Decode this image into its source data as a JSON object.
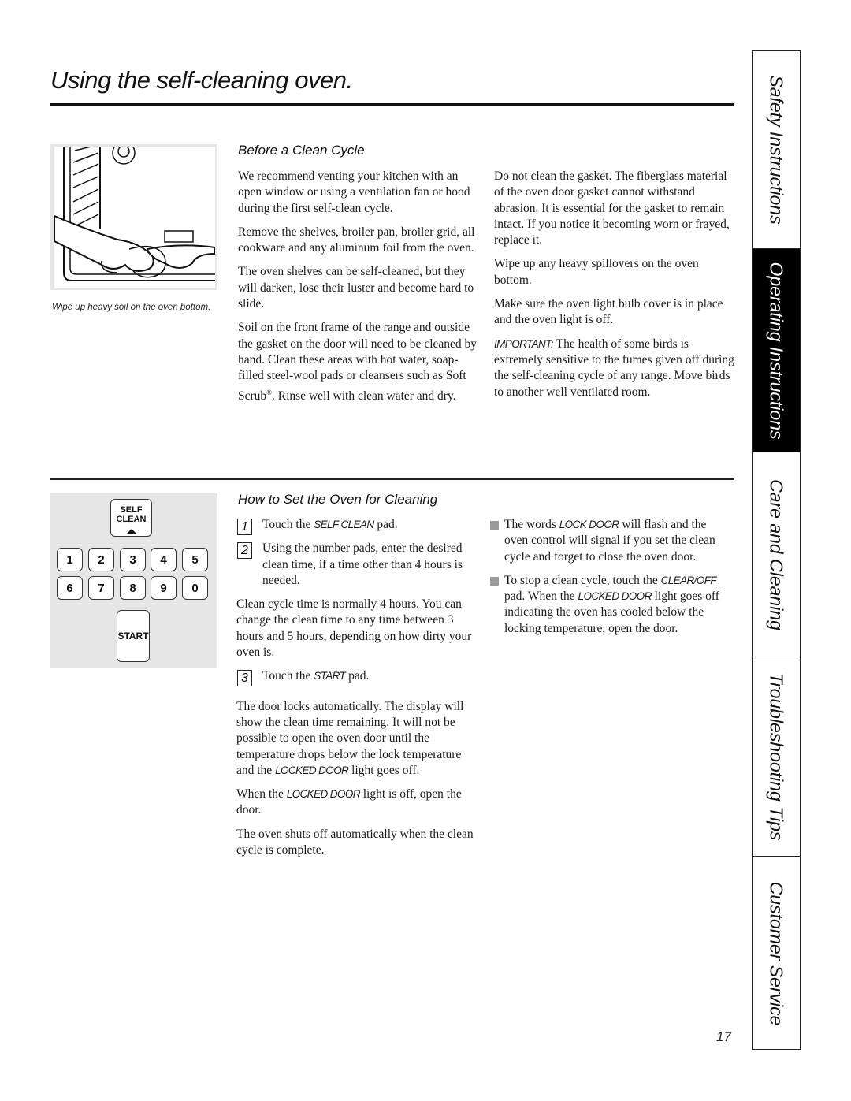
{
  "page": {
    "title": "Using the self-cleaning oven.",
    "number": "17"
  },
  "before_clean": {
    "heading": "Before a Clean Cycle",
    "figure_caption": "Wipe up heavy soil on the oven bottom.",
    "col1": [
      "We recommend venting your kitchen with an open window or using a ventilation fan or hood during the first self-clean cycle.",
      "Remove the shelves, broiler pan, broiler grid, all cookware and any aluminum foil from the oven.",
      "The oven shelves can be self-cleaned, but they will darken, lose their luster and become hard to slide."
    ],
    "col1_last": {
      "before": "Soil on the front frame of the range and outside the gasket on the door will need to be cleaned by hand. Clean these areas with hot water, soap-filled steel-wool pads or cleansers such as Soft Scrub",
      "reg": "®",
      "after": ". Rinse well with clean water and dry."
    },
    "col2": [
      "Do not clean the gasket. The fiberglass material of the oven door gasket cannot withstand abrasion. It is essential for the gasket to remain intact. If you notice it becoming worn or frayed, replace it.",
      "Wipe up any heavy spillovers on the oven bottom.",
      "Make sure the oven light bulb cover is in place and the oven light is off."
    ],
    "important": {
      "label": "IMPORTANT:",
      "text": " The health of some birds is extremely sensitive to the fumes given off during the self-cleaning cycle of any range. Move birds to another well ventilated room."
    }
  },
  "keypad": {
    "self_clean_line1": "SELF",
    "self_clean_line2": "CLEAN",
    "digits_row1": [
      "1",
      "2",
      "3",
      "4",
      "5"
    ],
    "digits_row2": [
      "6",
      "7",
      "8",
      "9",
      "0"
    ],
    "start": "START"
  },
  "how_to_set": {
    "heading": "How to Set the Oven for Cleaning",
    "steps": [
      {
        "num": "1",
        "pre": "Touch the ",
        "em": "SELF CLEAN",
        "post": " pad."
      },
      {
        "num": "2",
        "pre": "Using the number pads, enter the desired clean time, if a time other than 4 hours is needed.",
        "em": "",
        "post": ""
      },
      {
        "num": "3",
        "pre": "Touch the ",
        "em": "START",
        "post": " pad."
      }
    ],
    "cycle_time_note": "Clean cycle time is normally 4 hours. You can change the clean time to any time between 3 hours and 5 hours, depending on how dirty your oven is.",
    "door_locks": {
      "pre": "The door locks automatically. The display will show the clean time remaining. It will not be possible to open the oven door until the temperature drops below the lock temperature and the ",
      "em": "LOCKED DOOR",
      "post": " light goes off."
    },
    "when_off": {
      "pre": "When the ",
      "em": "LOCKED DOOR",
      "post": " light is off, open the door."
    },
    "shuts_off": "The oven shuts off automatically when the clean cycle is complete.",
    "bullets": [
      {
        "p1": "The words ",
        "e1": "LOCK DOOR",
        "p2": " will flash and the oven control will signal if you set the clean cycle and forget to close the oven door.",
        "e2": "",
        "p3": "",
        "e3": "",
        "p4": ""
      },
      {
        "p1": "To stop a clean cycle, touch the ",
        "e1": "CLEAR/OFF",
        "p2": " pad. When the ",
        "e2": "LOCKED DOOR",
        "p3": " light goes off indicating the oven has cooled below the locking temperature, open the door.",
        "e3": "",
        "p4": ""
      }
    ]
  },
  "side_tabs": [
    {
      "label": "Safety Instructions",
      "active": false
    },
    {
      "label": "Operating Instructions",
      "active": true
    },
    {
      "label": "Care and Cleaning",
      "active": false
    },
    {
      "label": "Troubleshooting Tips",
      "active": false
    },
    {
      "label": "Customer Service",
      "active": false
    }
  ],
  "colors": {
    "text": "#1a1a1a",
    "illustration_bg": "#e6e6e6",
    "active_tab_bg": "#000000",
    "bullet_square": "#9a9a9a"
  }
}
